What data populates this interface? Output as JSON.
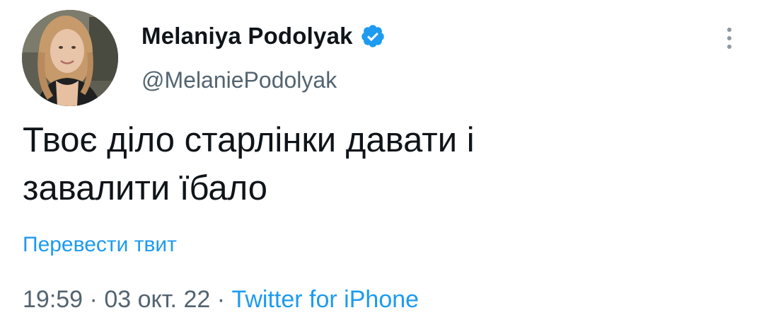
{
  "author": {
    "display_name": "Melaniya Podolyak",
    "handle": "@MelaniePodolyak",
    "verified": true,
    "verified_color": "#1d9bf0"
  },
  "tweet": {
    "text": "Твоє діло старлінки давати і\nзавалити їбало",
    "translate_label": "Перевести твит",
    "time": "19:59",
    "date": "03 окт. 22",
    "separator": " · ",
    "source": "Twitter for iPhone"
  },
  "icons": {
    "more": "more-vertical-icon",
    "verified": "verified-badge-icon"
  },
  "colors": {
    "text": "#0f1419",
    "secondary": "#536471",
    "link": "#1d9bf0"
  }
}
